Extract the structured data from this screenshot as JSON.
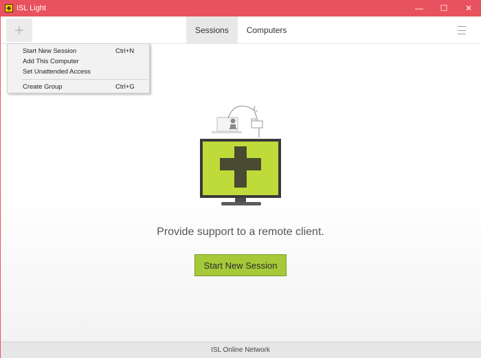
{
  "window": {
    "title": "ISL Light",
    "controls": {
      "minimize": "—",
      "maximize": "☐",
      "close": "✕"
    }
  },
  "toolbar": {
    "add_icon": "plus-icon",
    "tabs": [
      {
        "label": "Sessions",
        "active": true
      },
      {
        "label": "Computers",
        "active": false
      }
    ],
    "menu_icon": "hamburger-icon"
  },
  "dropdown": {
    "items": [
      {
        "label": "Start New Session",
        "shortcut": "Ctrl+N"
      },
      {
        "label": "Add This Computer",
        "shortcut": ""
      },
      {
        "label": "Set Unattended Access",
        "shortcut": ""
      },
      {
        "label": "Create Group",
        "shortcut": "Ctrl+G"
      }
    ]
  },
  "main": {
    "tagline": "Provide support to a remote client.",
    "cta_label": "Start New Session",
    "accent_color": "#a6c93a"
  },
  "footer": {
    "network_label": "ISL Online Network"
  }
}
